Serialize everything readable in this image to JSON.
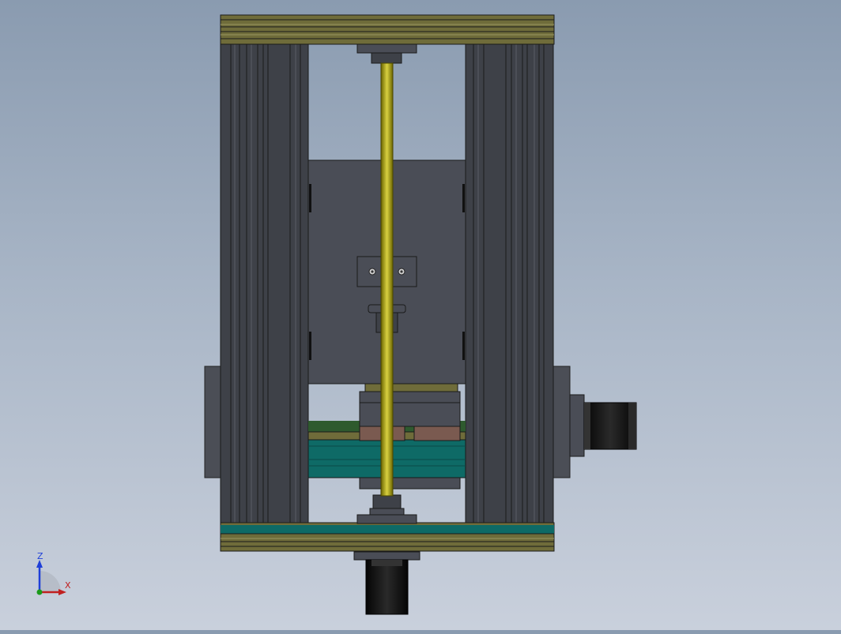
{
  "colors": {
    "background_top": "#8a9bb0",
    "background_bottom": "#c9d0dc",
    "frame_dark": "#3e4148",
    "plate": "#4a4d56",
    "leadscrew": "#a8a000",
    "rail_olive": "#6f6c3a",
    "rail_teal": "#0e6a66",
    "motor_black": "#101010",
    "axis_z": "#1f3fd8",
    "axis_x": "#c02020"
  },
  "triad": {
    "z_label": "Z",
    "x_label": "X"
  }
}
